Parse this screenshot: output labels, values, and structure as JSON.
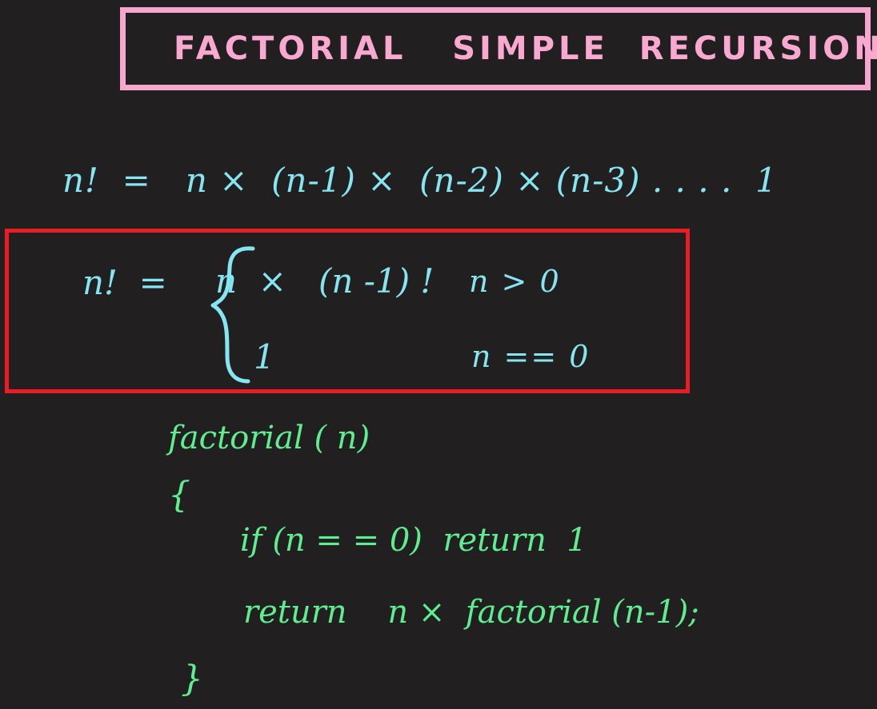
{
  "page": {
    "background_color": "#211f1f",
    "accent_pink": "#f9a8cf",
    "accent_red": "#ec1c24",
    "accent_cyan": "#85e6f2",
    "accent_green": "#5eee90"
  },
  "title": {
    "word1": "FACTORIAL",
    "word2": "SIMPLE",
    "word3": "RECURSION",
    "full": "FACTORIAL   SIMPLE  RECURSION"
  },
  "formula_expanded": {
    "text": "n!  =   n ×  (n-1) ×  (n-2) × (n-3) . . . .  1"
  },
  "recursive_definition": {
    "lhs": "n!  =",
    "case1_value": "n  ×   (n -1) !",
    "case1_condition": "n > 0",
    "case2_value": "1",
    "case2_condition": "n == 0"
  },
  "pseudocode": {
    "lines": [
      "factorial ( n)",
      "{",
      "if (n = = 0)  return  1",
      "return    n ×  factorial (n-1);",
      "}"
    ],
    "line0": "factorial ( n)",
    "line1": "{",
    "line2": "if (n = = 0)  return  1",
    "line3": "return    n ×  factorial (n-1);",
    "line4": "}"
  }
}
